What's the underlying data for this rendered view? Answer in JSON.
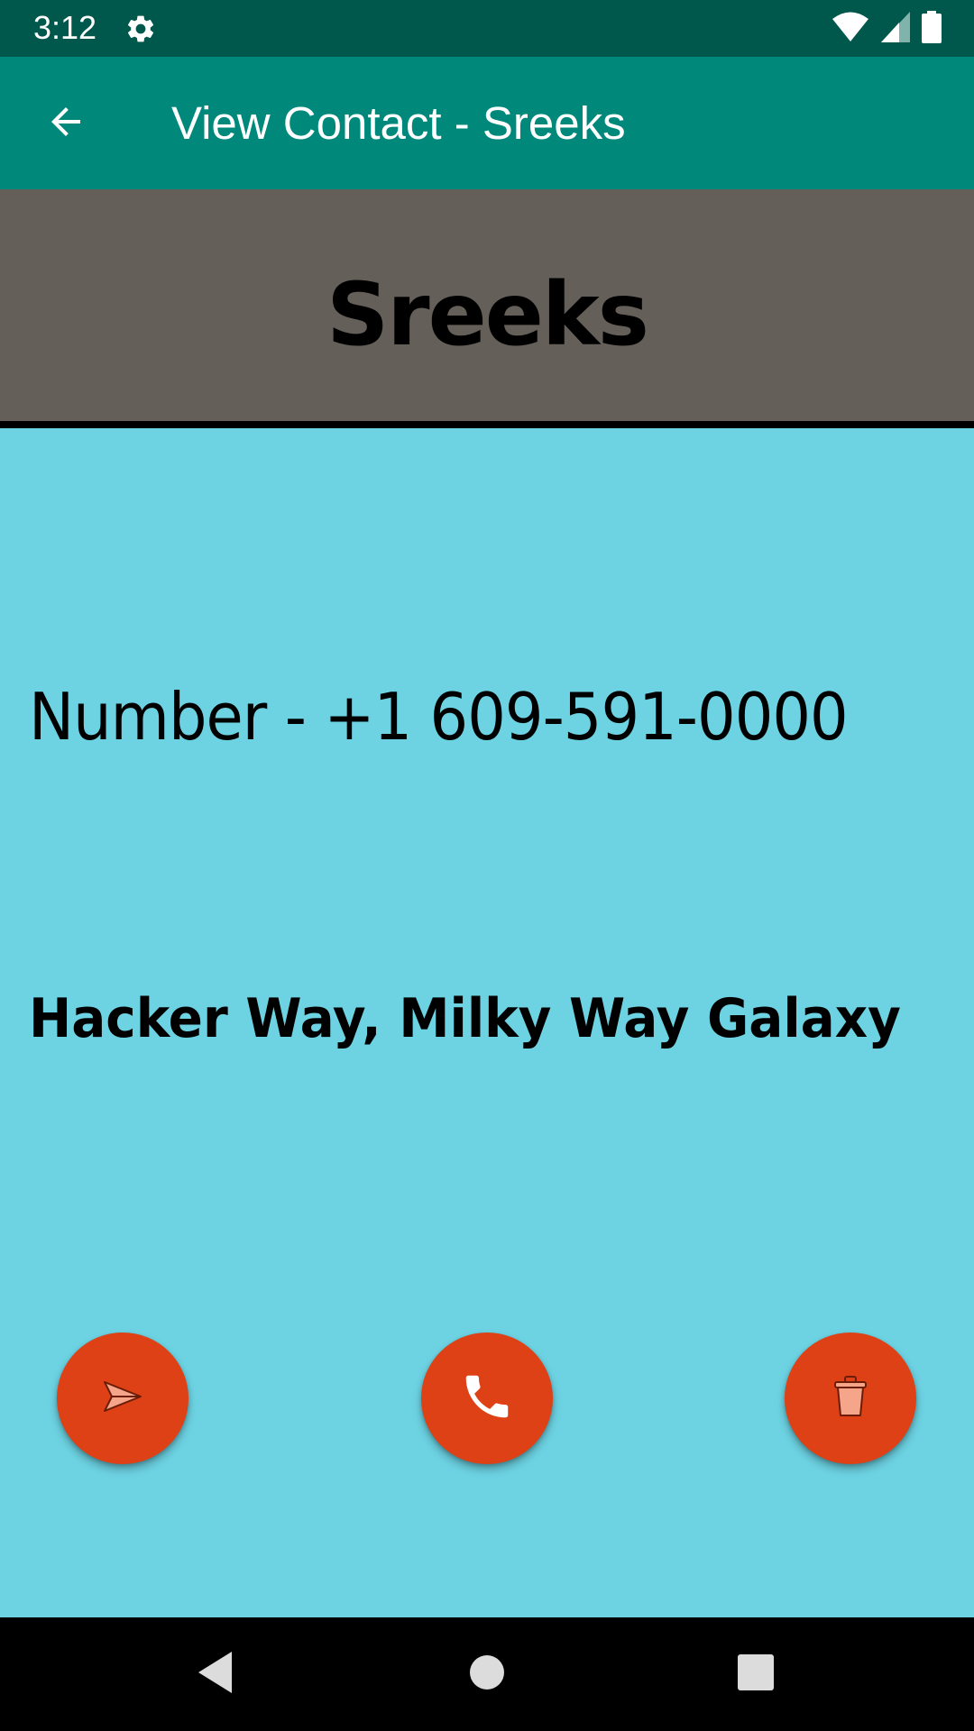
{
  "status_bar": {
    "time": "3:12",
    "icons": [
      "settings-icon",
      "wifi-icon",
      "cellular-signal-icon",
      "battery-icon"
    ],
    "background": "#00574b"
  },
  "app_bar": {
    "title": "View Contact - Sreeks",
    "back_icon": "arrow-back-icon",
    "background": "#00897b"
  },
  "contact": {
    "name": "Sreeks",
    "number_line": "Number - +1 609-591-0000",
    "address": "Hacker Way, Milky Way Galaxy",
    "header_background": "#655f59",
    "body_background": "#6dd3e3"
  },
  "actions": [
    {
      "name": "send-message",
      "icon": "send-icon"
    },
    {
      "name": "call",
      "icon": "phone-icon"
    },
    {
      "name": "delete",
      "icon": "trash-icon"
    }
  ],
  "fab_color": "#dd4115",
  "nav_bar": {
    "buttons": [
      "back-triangle-icon",
      "home-circle-icon",
      "recents-square-icon"
    ]
  }
}
